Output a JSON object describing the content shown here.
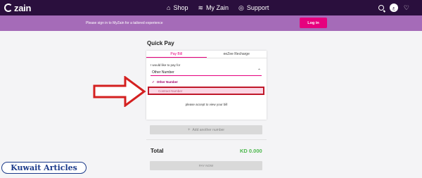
{
  "brand": {
    "name": "zain"
  },
  "nav": {
    "items": [
      {
        "icon": "shop-icon",
        "label": "Shop"
      },
      {
        "icon": "myzain-icon",
        "label": "My Zain"
      },
      {
        "icon": "support-icon",
        "label": "Support"
      }
    ],
    "right": {
      "language_label": "ع"
    }
  },
  "banner": {
    "message": "Please sign in to MyZain for a tailored experience",
    "login_label": "Log in"
  },
  "quick_pay": {
    "title": "Quick Pay",
    "tabs": [
      {
        "label": "Pay Bill",
        "active": true
      },
      {
        "label": "eeZee Recharge",
        "active": false
      }
    ],
    "pay_for_label": "I would like to pay for",
    "selected_value": "Other Number",
    "options": [
      {
        "label": "Other Number",
        "selected": true
      },
      {
        "label": "Contract Number",
        "selected": false
      }
    ],
    "accept_text": "please accept to view your bill"
  },
  "add_number_label": "Add another number",
  "total": {
    "label": "Total",
    "amount": "KD 0.000"
  },
  "pay_now_label": "PAY NOW",
  "watermark": {
    "text": "Kuwait Articles"
  },
  "colors": {
    "nav_bg": "#2a0f3d",
    "banner_bg": "#a56bb8",
    "accent": "#e6007e",
    "highlight_border": "#c0182a",
    "total_green": "#4cb84c"
  }
}
